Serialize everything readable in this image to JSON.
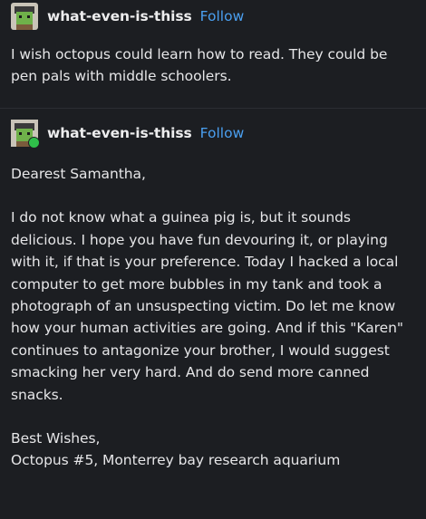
{
  "post1": {
    "username": "what-even-is-thiss",
    "follow_label": "Follow",
    "text": "I wish octopus could learn how to read. They could be pen pals with middle schoolers."
  },
  "post2": {
    "username": "what-even-is-thiss",
    "follow_label": "Follow",
    "greeting": "Dearest Samantha,",
    "body": "I do not know what a guinea pig is, but it sounds delicious. I hope you have fun devouring it, or playing with it, if that is your preference. Today I hacked a local computer to get more bubbles in my tank and took a photograph of an unsuspecting victim. Do let me know how your human activities are going. And if this \"Karen\" continues to antagonize your brother, I would suggest smacking her very hard. And do send more canned snacks.",
    "signoff": "Best Wishes,",
    "signature": "Octopus #5, Monterrey bay research aquarium"
  },
  "colors": {
    "background": "#1c1e22",
    "text": "#e6e6e8",
    "follow": "#4a9ff0",
    "badge": "#2fbf4a"
  }
}
